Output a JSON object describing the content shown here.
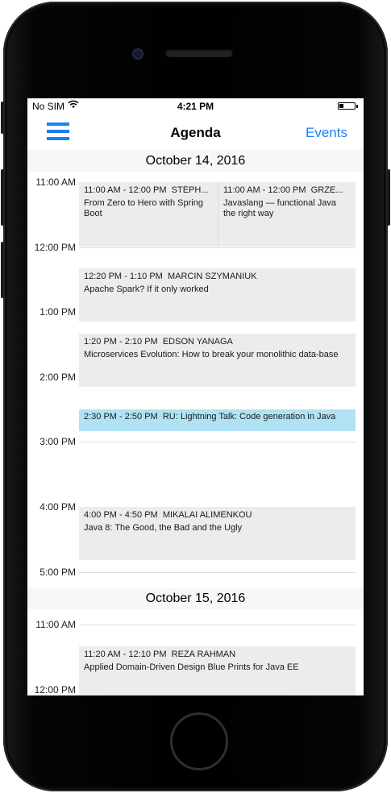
{
  "status_bar": {
    "carrier": "No SIM",
    "wifi_icon": "wifi-icon",
    "time": "4:21 PM",
    "battery_level": 0.3
  },
  "nav": {
    "menu_icon": "hamburger-menu-icon",
    "title": "Agenda",
    "right_button": "Events"
  },
  "days": [
    {
      "date": "October 14, 2016",
      "hours": [
        "11:00 AM",
        "12:00 PM",
        "1:00 PM",
        "2:00 PM",
        "3:00 PM",
        "4:00 PM",
        "5:00 PM"
      ],
      "events": [
        {
          "time": "11:00 AM - 12:00 PM",
          "speaker": "STÉPH...",
          "title": "From Zero to Hero with Spring Boot"
        },
        {
          "time": "11:00 AM - 12:00 PM",
          "speaker": "GRZE...",
          "title": "Javaslang — functional Java the right way"
        },
        {
          "time": "12:20 PM - 1:10 PM",
          "speaker": "MARCIN SZYMANIUK",
          "title": "Apache Spark? If it only worked"
        },
        {
          "time": "1:20 PM - 2:10 PM",
          "speaker": "EDSON YANAGA",
          "title": "Microservices Evolution: How to break your monolithic data-base"
        },
        {
          "time": "2:30 PM - 2:50 PM",
          "speaker": "RU: Lightning Talk: Code generation in Java",
          "title": ""
        },
        {
          "time": "4:00 PM - 4:50 PM",
          "speaker": "MIKALAI ALIMENKOU",
          "title": "Java 8: The Good, the Bad and the Ugly"
        }
      ]
    },
    {
      "date": "October 15, 2016",
      "hours": [
        "11:00 AM",
        "12:00 PM"
      ],
      "events": [
        {
          "time": "11:20 AM - 12:10 PM",
          "speaker": "REZA RAHMAN",
          "title": "Applied Domain-Driven Design Blue Prints for Java EE"
        }
      ]
    }
  ]
}
